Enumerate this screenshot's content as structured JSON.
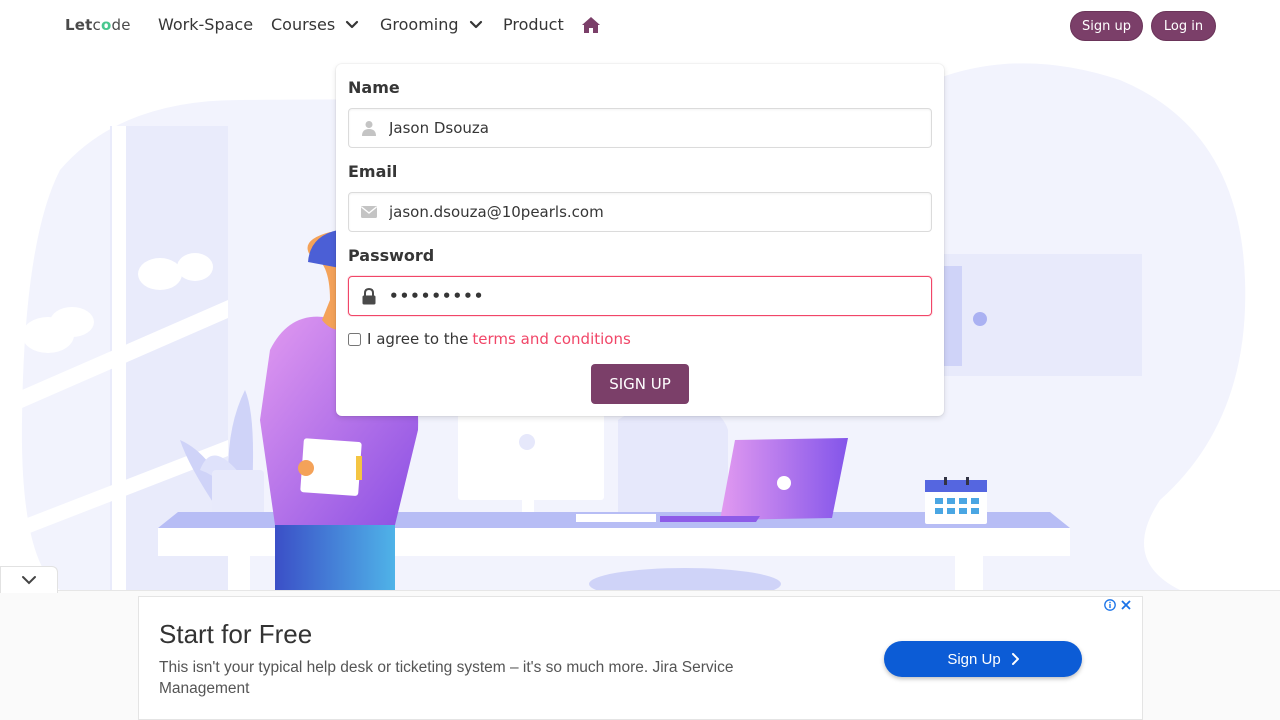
{
  "brand": {
    "part1": "Let",
    "part2": "c",
    "part3": "o",
    "part4": "de"
  },
  "nav": {
    "items": [
      {
        "label": "Work-Space"
      },
      {
        "label": "Courses"
      },
      {
        "label": "Grooming"
      },
      {
        "label": "Product"
      }
    ],
    "signup_label": "Sign up",
    "login_label": "Log in"
  },
  "form": {
    "name_label": "Name",
    "name_value": "Jason Dsouza",
    "email_label": "Email",
    "email_value": "jason.dsouza@10pearls.com",
    "password_label": "Password",
    "password_value": "•••••••••",
    "agree_text": "I agree to the",
    "terms_link": "terms and conditions",
    "submit_label": "SIGN UP"
  },
  "ad": {
    "title": "Start for Free",
    "description": "This isn't your typical help desk or ticketing system – it's so much more. Jira Service Management",
    "cta_label": "Sign Up"
  },
  "colors": {
    "accent": "#7b3f69",
    "danger": "#f14668",
    "ad_button": "#0c5cd6"
  },
  "icons": [
    "chevron-down-icon",
    "home-icon",
    "user-icon",
    "envelope-icon",
    "lock-icon",
    "info-icon",
    "close-icon",
    "chevron-right-icon"
  ]
}
